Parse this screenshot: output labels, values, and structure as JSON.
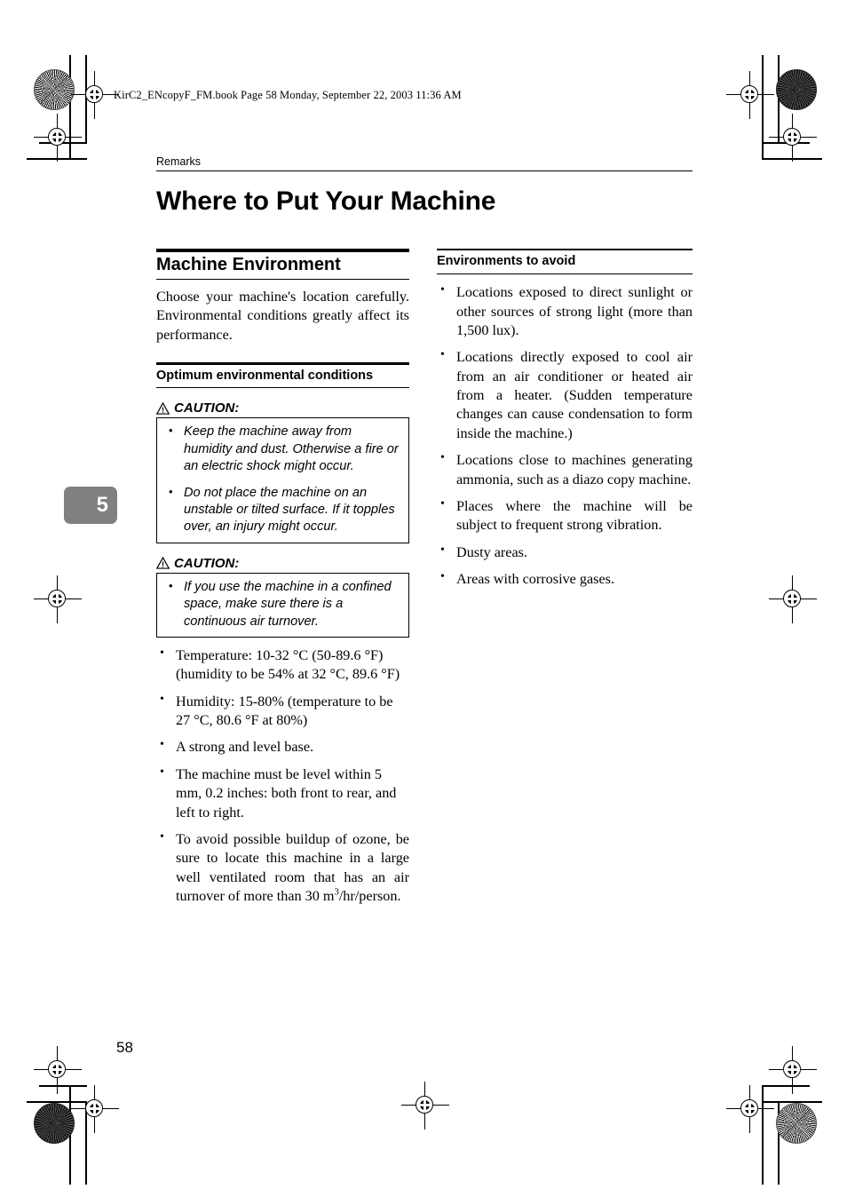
{
  "document": {
    "file_header": "KirC2_ENcopyF_FM.book  Page 58  Monday, September 22, 2003  11:36 AM",
    "running_head": "Remarks",
    "chapter_title": "Where to Put Your Machine",
    "chapter_tab": "5",
    "page_number": "58",
    "accent_colors": {
      "tab_background": "#808080",
      "tab_text": "#ffffff",
      "rule": "#000000"
    }
  },
  "left_column": {
    "section_heading": "Machine Environment",
    "intro_paragraph": "Choose your machine's location carefully. Environmental conditions greatly affect its performance.",
    "subsection_heading": "Optimum environmental conditions",
    "caution_blocks": [
      {
        "label": "CAUTION:",
        "items": [
          "Keep the machine away from humidity and dust. Otherwise a fire or an electric shock might occur.",
          "Do not place the machine on an unstable or tilted surface. If it topples over, an injury might occur."
        ]
      },
      {
        "label": "CAUTION:",
        "items": [
          "If you use the machine in a confined space, make sure there is a continuous air turnover."
        ]
      }
    ],
    "conditions": [
      "Temperature: 10-32 °C (50-89.6 °F) (humidity to be 54% at 32 °C, 89.6 °F)",
      "Humidity: 15-80% (temperature to be 27 °C, 80.6 °F at 80%)",
      "A strong and level base.",
      "The machine must be level within 5 mm, 0.2 inches: both front to rear, and left to right."
    ],
    "ozone_item": {
      "before": "To avoid possible buildup of ozone, be sure to locate this machine in a large well ventilated room that has an air turnover of more than 30 m",
      "superscript": "3",
      "after": "/hr/person."
    }
  },
  "right_column": {
    "subsection_heading": "Environments to avoid",
    "items": [
      "Locations exposed to direct sunlight or other sources of strong light (more than 1,500 lux).",
      "Locations directly exposed to cool air from an air conditioner or heated air from a heater. (Sudden temperature changes can cause condensation to form inside the machine.)",
      "Locations close to machines generating ammonia, such as a diazo copy machine.",
      "Places where the machine will be subject to frequent strong vibration.",
      "Dusty areas.",
      "Areas with corrosive gases."
    ]
  }
}
